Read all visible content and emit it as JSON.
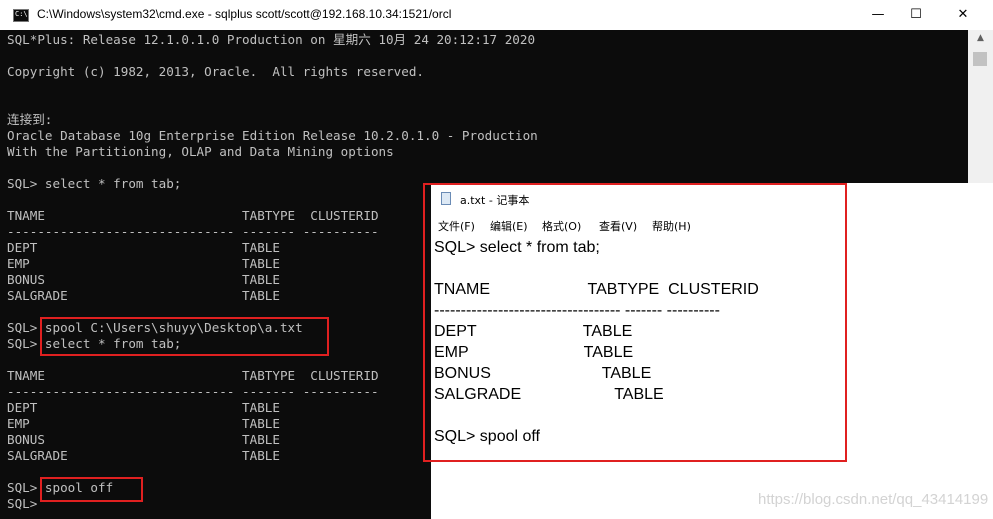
{
  "cmd": {
    "title": "C:\\Windows\\system32\\cmd.exe - sqlplus   scott/scott@192.168.10.34:1521/orcl",
    "icon_text": "C:\\",
    "controls": {
      "minimize": "—",
      "maximize": "☐",
      "close": "✕"
    },
    "lines": [
      "SQL*Plus: Release 12.1.0.1.0 Production on 星期六 10月 24 20:12:17 2020",
      "",
      "Copyright (c) 1982, 2013, Oracle.  All rights reserved.",
      "",
      "",
      "连接到:",
      "Oracle Database 10g Enterprise Edition Release 10.2.0.1.0 - Production",
      "With the Partitioning, OLAP and Data Mining options",
      "",
      "SQL> select * from tab;",
      "",
      "TNAME                          TABTYPE  CLUSTERID",
      "------------------------------ ------- ----------",
      "DEPT                           TABLE",
      "EMP                            TABLE",
      "BONUS                          TABLE",
      "SALGRADE                       TABLE",
      "",
      "SQL> spool C:\\Users\\shuyy\\Desktop\\a.txt",
      "SQL> select * from tab;",
      "",
      "TNAME                          TABTYPE  CLUSTERID",
      "------------------------------ ------- ----------",
      "DEPT                           TABLE",
      "EMP                            TABLE",
      "BONUS                          TABLE",
      "SALGRADE                       TABLE",
      "",
      "SQL> spool off",
      "SQL>"
    ]
  },
  "notepad": {
    "title": "a.txt - 记事本",
    "menu": [
      "文件(F)",
      "编辑(E)",
      "格式(O)",
      "查看(V)",
      "帮助(H)"
    ],
    "lines": [
      "SQL> select * from tab;",
      "",
      "TNAME                      TABTYPE  CLUSTERID",
      "----------------------------------- ------- ----------",
      "DEPT                        TABLE",
      "EMP                          TABLE",
      "BONUS                         TABLE",
      "SALGRADE                     TABLE",
      "",
      "SQL> spool off"
    ]
  },
  "watermark": "https://blog.csdn.net/qq_43414199",
  "colors": {
    "highlight": "#e02020",
    "console_bg": "#0c0c0c",
    "console_fg": "#c0c0c0"
  }
}
